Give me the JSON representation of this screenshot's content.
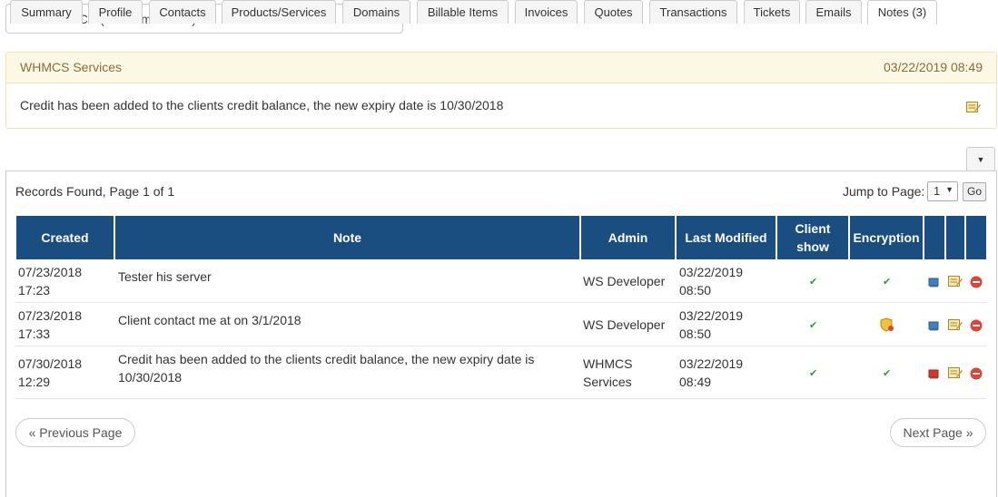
{
  "client_selector": {
    "value": "Dev WHMCS (devwhmcs.com)"
  },
  "sticky_note": {
    "title": "WHMCS Services",
    "date": "03/22/2019 08:49",
    "text": "Credit has been added to the clients credit balance, the new expiry date is 10/30/2018"
  },
  "tabs": [
    {
      "label": "Summary"
    },
    {
      "label": "Profile"
    },
    {
      "label": "Contacts"
    },
    {
      "label": "Products/Services"
    },
    {
      "label": "Domains"
    },
    {
      "label": "Billable Items"
    },
    {
      "label": "Invoices"
    },
    {
      "label": "Quotes"
    },
    {
      "label": "Transactions"
    },
    {
      "label": "Tickets"
    },
    {
      "label": "Emails"
    },
    {
      "label": "Notes (3)"
    }
  ],
  "active_tab": "Notes (3)",
  "records": {
    "found_text": "Records Found, Page 1 of 1",
    "jump_label": "Jump to Page:",
    "page_value": "1",
    "go_label": "Go"
  },
  "table": {
    "headers": {
      "created": "Created",
      "note": "Note",
      "admin": "Admin",
      "last_modified": "Last Modified",
      "client_show_1": "Client",
      "client_show_2": "show",
      "encryption": "Encryption"
    },
    "rows": [
      {
        "created_date": "07/23/2018",
        "created_time": "17:23",
        "note_1": "Tester his server",
        "note_2": "",
        "admin_1": "WS Developer",
        "admin_2": "",
        "modified_date": "03/22/2019",
        "modified_time": "08:50",
        "client_show": "yes",
        "encryption": "yes",
        "sticky_flag": "blue"
      },
      {
        "created_date": "07/23/2018",
        "created_time": "17:33",
        "note_1": "Client contact me at on 3/1/2018",
        "note_2": "",
        "admin_1": "WS Developer",
        "admin_2": "",
        "modified_date": "03/22/2019",
        "modified_time": "08:50",
        "client_show": "yes",
        "encryption": "shield",
        "sticky_flag": "blue"
      },
      {
        "created_date": "07/30/2018",
        "created_time": "12:29",
        "note_1": "Credit has been added to the clients credit balance, the new expiry date is",
        "note_2": "10/30/2018",
        "admin_1": "WHMCS",
        "admin_2": "Services",
        "modified_date": "03/22/2019",
        "modified_time": "08:49",
        "client_show": "yes",
        "encryption": "yes",
        "sticky_flag": "red"
      }
    ]
  },
  "pager": {
    "prev_label": "« Previous Page",
    "next_label": "Next Page »"
  },
  "colors": {
    "header_blue": "#1a4d80",
    "sticky_bg": "#fcf8e3",
    "sticky_text": "#8a6d3b",
    "check_green": "#2e9e3b",
    "delete_red": "#e0433a",
    "flag_blue": "#3b82c4",
    "flag_red": "#d9342b"
  }
}
